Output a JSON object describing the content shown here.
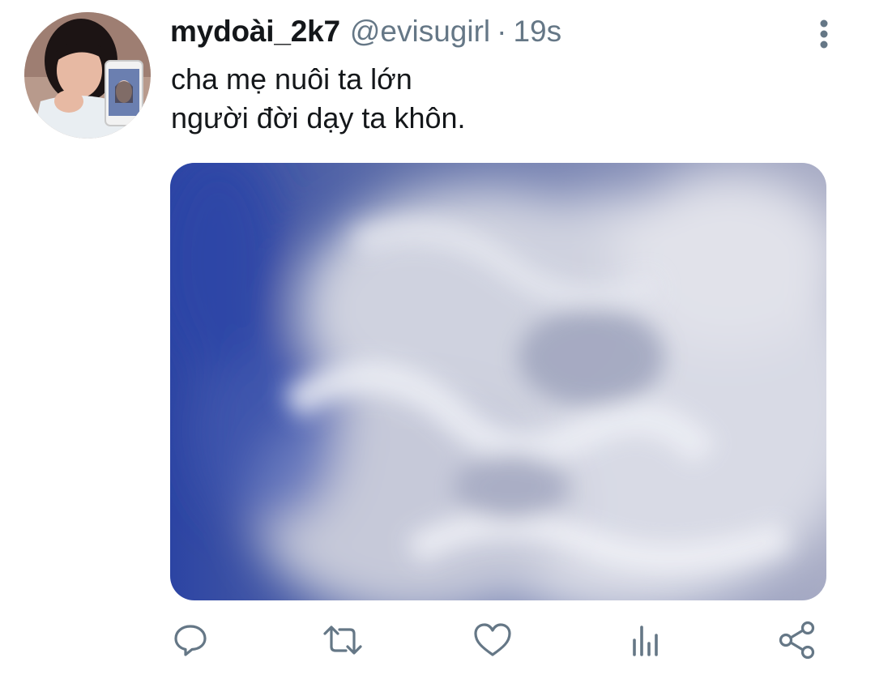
{
  "user": {
    "display_name": "mydoài_2k7",
    "handle": "@evisugirl",
    "separator": "·",
    "timestamp": "19s"
  },
  "tweet": {
    "lines": [
      "cha mẹ nuôi ta lớn",
      "người đời dạy ta khôn."
    ]
  },
  "actions": {
    "icons": [
      "reply-icon",
      "retweet-icon",
      "like-icon",
      "analytics-icon",
      "share-icon"
    ]
  },
  "colors": {
    "text_primary": "#14171a",
    "text_secondary": "#657786",
    "icon": "#657786",
    "media_blue": "#2f4aa8",
    "smoke": "#d9dbe6"
  }
}
